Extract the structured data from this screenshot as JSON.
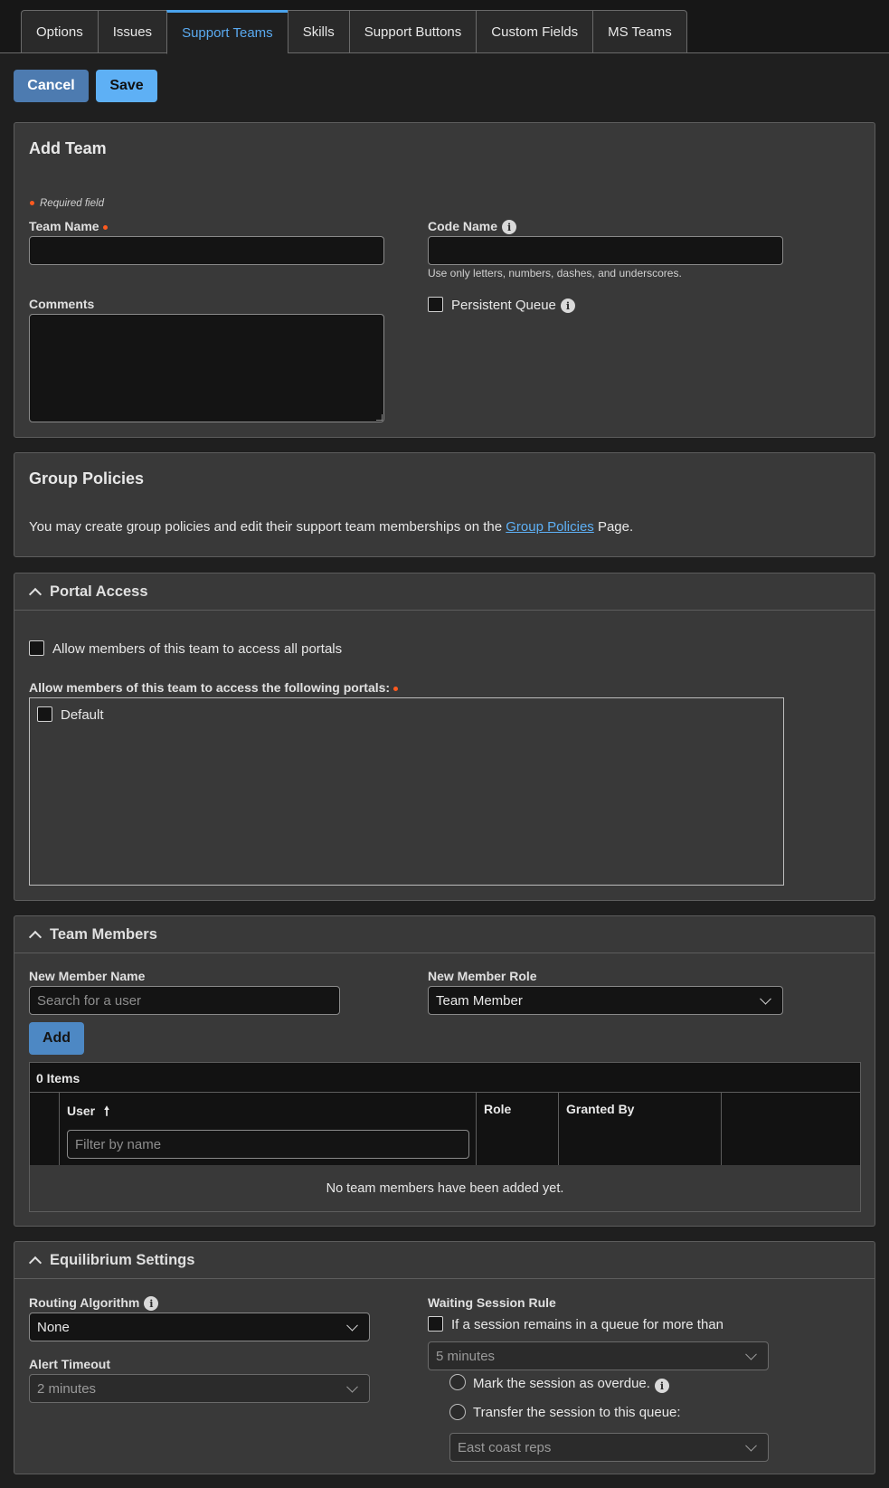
{
  "tabs": [
    "Options",
    "Issues",
    "Support Teams",
    "Skills",
    "Support Buttons",
    "Custom Fields",
    "MS Teams"
  ],
  "actions": {
    "cancel": "Cancel",
    "save": "Save"
  },
  "add_team": {
    "title": "Add Team",
    "required_note": "Required field",
    "team_name_label": "Team Name",
    "team_name_value": "",
    "code_name_label": "Code Name",
    "code_name_value": "",
    "code_name_hint": "Use only letters, numbers, dashes, and underscores.",
    "comments_label": "Comments",
    "comments_value": "",
    "persistent_queue_label": "Persistent Queue"
  },
  "group_policies": {
    "title": "Group Policies",
    "text_before": "You may create group policies and edit their support team memberships on the ",
    "link_text": "Group Policies",
    "text_after": " Page."
  },
  "portal_access": {
    "title": "Portal Access",
    "all_portals_label": "Allow members of this team to access all portals",
    "following_label": "Allow members of this team to access the following portals:",
    "portals": [
      "Default"
    ]
  },
  "team_members": {
    "title": "Team Members",
    "new_member_name_label": "New Member Name",
    "search_placeholder": "Search for a user",
    "new_member_role_label": "New Member Role",
    "role_value": "Team Member",
    "add_button": "Add",
    "items_count": "0 Items",
    "columns": [
      "User",
      "Role",
      "Granted By"
    ],
    "sort_arrow": "🠕",
    "filter_placeholder": "Filter by name",
    "empty_message": "No team members have been added yet."
  },
  "equilibrium": {
    "title": "Equilibrium Settings",
    "routing_algorithm_label": "Routing Algorithm",
    "routing_algorithm_value": "None",
    "alert_timeout_label": "Alert Timeout",
    "alert_timeout_value": "2 minutes",
    "waiting_rule_label": "Waiting Session Rule",
    "waiting_rule_checkbox": "If a session remains in a queue for more than",
    "waiting_time_value": "5 minutes",
    "overdue_option": "Mark the session as overdue.",
    "transfer_option": "Transfer the session to this queue:",
    "transfer_queue_value": "East coast reps"
  },
  "colors": {
    "accent": "#5eb0f5",
    "required": "#ff5a1f",
    "panel": "#393939",
    "background": "#1f1f1f"
  }
}
